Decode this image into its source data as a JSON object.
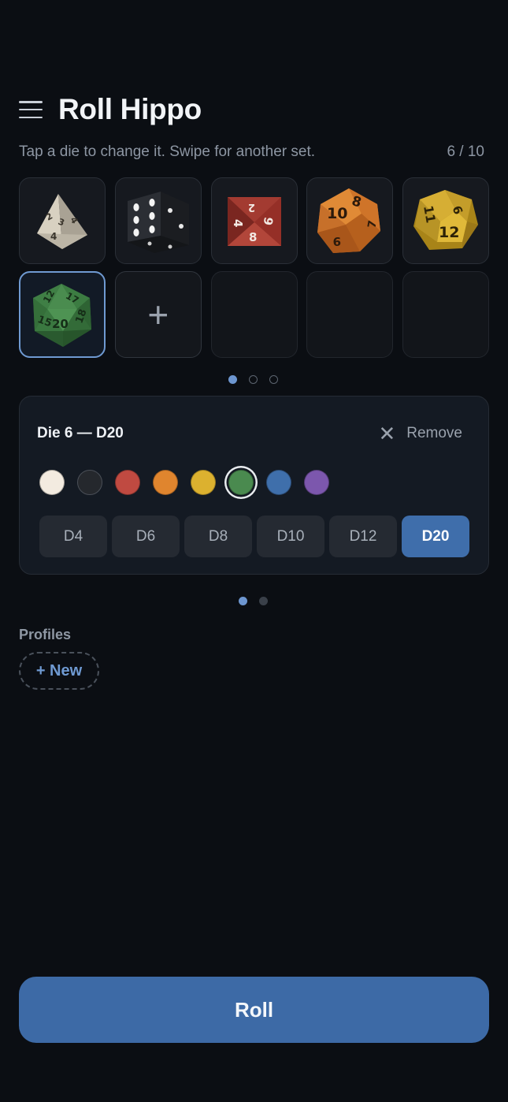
{
  "app": {
    "title": "Roll Hippo",
    "menu_icon": "hamburger-menu-icon"
  },
  "subtitle": "Tap a die to change it. Swipe for another set.",
  "set_counter": "6 / 10",
  "dice_slots": [
    {
      "type": "D4",
      "color": "#cfc8b8",
      "numbers": [
        "2",
        "3",
        "4",
        "4"
      ]
    },
    {
      "type": "D6",
      "color": "#2a2d33",
      "numbers": []
    },
    {
      "type": "D8",
      "color": "#9c3a30",
      "numbers": [
        "2",
        "4",
        "6",
        "8"
      ]
    },
    {
      "type": "D10",
      "color": "#d57a2a",
      "numbers": [
        "10",
        "8",
        "9",
        "7"
      ]
    },
    {
      "type": "D12",
      "color": "#c9a22f",
      "numbers": [
        "11",
        "9",
        "12"
      ]
    },
    {
      "type": "D20",
      "color": "#3f7a45",
      "numbers": [
        "12",
        "17",
        "15",
        "18",
        "20"
      ],
      "selected": true
    },
    {
      "type": "add",
      "icon": "plus-icon",
      "label": "+"
    },
    {
      "type": "empty"
    },
    {
      "type": "empty"
    },
    {
      "type": "empty"
    }
  ],
  "dice_pager": {
    "count": 3,
    "active": 0
  },
  "editor": {
    "title": "Die 6 — D20",
    "remove_label": "Remove",
    "remove_icon": "close-icon",
    "colors": [
      "#f3ebe0",
      "#25282d",
      "#c04a41",
      "#e0852e",
      "#dcb12f",
      "#4a8a4f",
      "#3f6fab",
      "#7c57ad"
    ],
    "selected_color_index": 5,
    "types": [
      "D4",
      "D6",
      "D8",
      "D10",
      "D12",
      "D20"
    ],
    "selected_type": "D20"
  },
  "editor_pager": {
    "count": 2,
    "active": 0
  },
  "profiles": {
    "label": "Profiles",
    "new_label": "+ New"
  },
  "roll_label": "Roll"
}
